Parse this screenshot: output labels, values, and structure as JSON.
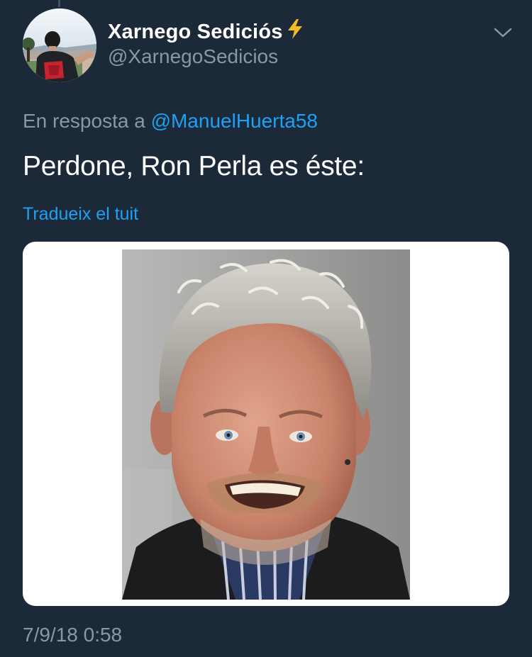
{
  "tweet": {
    "display_name": "Xarnego Sediciós",
    "handle": "@XarnegoSedicios",
    "reply_prefix": "En resposta a",
    "reply_to": "@ManuelHuerta58",
    "text": "Perdone, Ron Perla es éste:",
    "translate_label": "Tradueix el tuit",
    "timestamp": "7/9/18 0:58"
  },
  "icons": {
    "badge": "lightning-bolt-icon",
    "menu": "chevron-down-icon"
  },
  "colors": {
    "background": "#1c2938",
    "link": "#1da1f2",
    "secondary_text": "#8899a6",
    "primary_text": "#ffffff",
    "bolt": "#f5b921"
  }
}
